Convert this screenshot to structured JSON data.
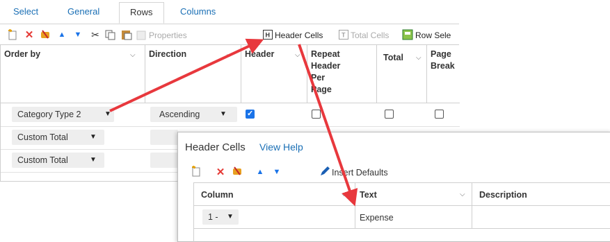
{
  "tabs": [
    {
      "label": "Select"
    },
    {
      "label": "General"
    },
    {
      "label": "Rows",
      "active": true
    },
    {
      "label": "Columns"
    }
  ],
  "toolbar": {
    "icons": [
      "new-icon",
      "delete-icon",
      "clear-icon",
      "move-up-icon",
      "move-down-icon",
      "cut-icon",
      "copy-icon",
      "paste-icon"
    ],
    "properties_label": "Properties",
    "header_cells_label": "Header Cells",
    "total_cells_label": "Total Cells",
    "row_select_label": "Row Sele"
  },
  "grid": {
    "columns": [
      {
        "label": "Order by"
      },
      {
        "label": "Direction"
      },
      {
        "label": "Header"
      },
      {
        "label_lines": [
          "Repeat",
          "Header",
          "Per",
          "Page"
        ]
      },
      {
        "label": "Total"
      },
      {
        "label_lines": [
          "Page",
          "Break"
        ]
      }
    ],
    "rows": [
      {
        "order_by": "Category Type 2",
        "direction": "Ascending",
        "header": true,
        "repeat": false,
        "total": false,
        "page_break": false
      },
      {
        "order_by": "Custom Total",
        "direction": ""
      },
      {
        "order_by": "Custom Total",
        "direction": ""
      }
    ]
  },
  "popup": {
    "title": "Header Cells",
    "help_link": "View Help",
    "insert_defaults_label": "Insert Defaults",
    "columns": [
      {
        "label": "Column"
      },
      {
        "label": "Text"
      },
      {
        "label": "Description"
      }
    ],
    "rows": [
      {
        "column": "1 -",
        "text": "Expense",
        "description": ""
      }
    ]
  },
  "colors": {
    "link": "#1a6fb5",
    "arrow": "#e8383d",
    "checkbox_on": "#1a73e8"
  }
}
